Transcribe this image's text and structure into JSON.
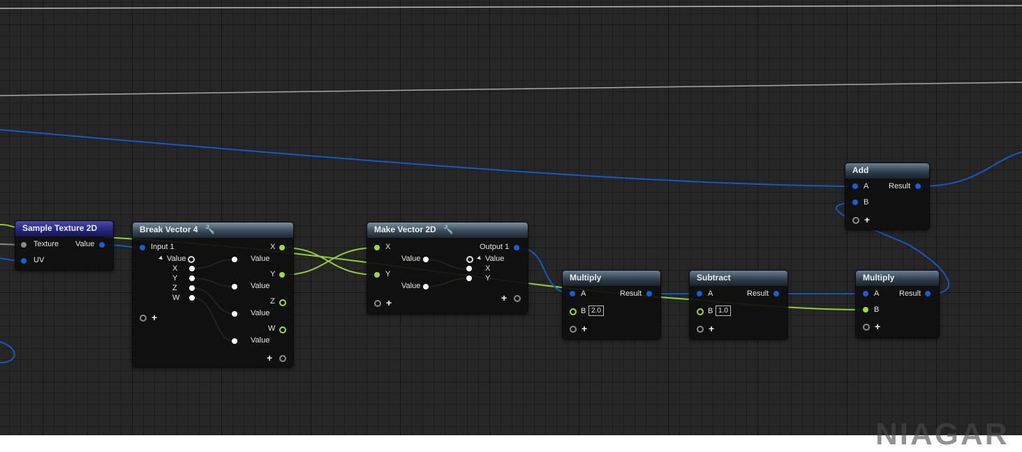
{
  "watermark": "NIAGAR",
  "nodes": {
    "sample_texture": {
      "title": "Sample Texture 2D",
      "in_texture": "Texture",
      "in_uv": "UV",
      "out_value": "Value"
    },
    "break_vector": {
      "title": "Break Vector 4",
      "in_input": "Input 1",
      "struct_value": "Value",
      "sub": [
        "X",
        "Y",
        "Z",
        "W"
      ],
      "outs": [
        "X",
        "Y",
        "Z",
        "W"
      ],
      "out_value": "Value"
    },
    "make_vector": {
      "title": "Make Vector 2D",
      "in_x": "X",
      "in_y": "Y",
      "in_value": "Value",
      "out": "Output 1",
      "struct_value": "Value",
      "sub": [
        "X",
        "Y"
      ]
    },
    "multiply1": {
      "title": "Multiply",
      "a": "A",
      "b": "B",
      "b_value": "2.0",
      "result": "Result"
    },
    "subtract": {
      "title": "Subtract",
      "a": "A",
      "b": "B",
      "b_value": "1.0",
      "result": "Result"
    },
    "multiply2": {
      "title": "Multiply",
      "a": "A",
      "b": "B",
      "result": "Result"
    },
    "add": {
      "title": "Add",
      "a": "A",
      "b": "B",
      "result": "Result"
    }
  },
  "colors": {
    "float_pin": "#1560d8",
    "vector_pin": "#9ddc3c",
    "wire_blue": "#1458c8",
    "wire_green": "#8fcf3a"
  }
}
